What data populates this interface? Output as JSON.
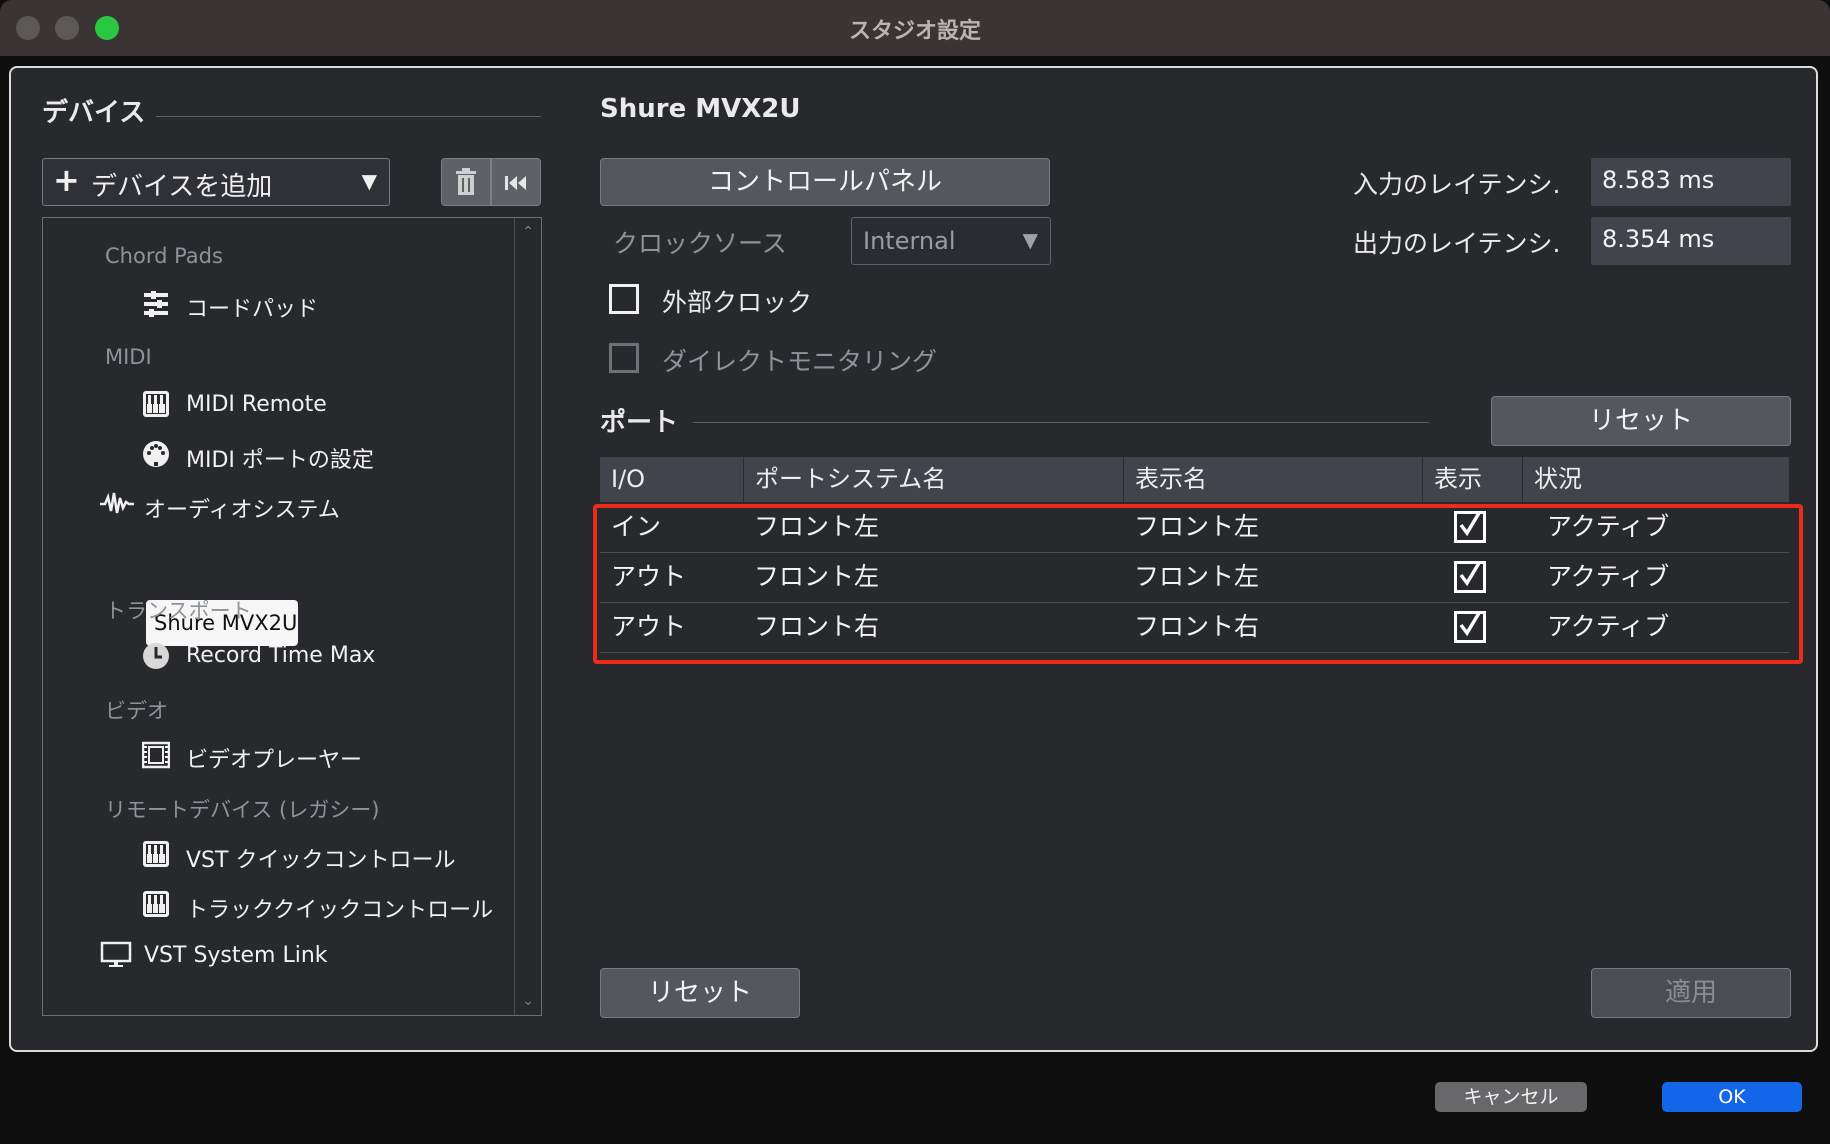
{
  "window": {
    "title": "スタジオ設定"
  },
  "devices": {
    "title": "デバイス",
    "add_label": "デバイスを追加",
    "tree": [
      {
        "kind": "category",
        "label": "Chord Pads"
      },
      {
        "kind": "item",
        "label": "コードパッド",
        "icon": "chord-pads-icon"
      },
      {
        "kind": "category",
        "label": "MIDI"
      },
      {
        "kind": "item",
        "label": "MIDI Remote",
        "icon": "midi-keyboard-icon"
      },
      {
        "kind": "item",
        "label": "MIDI ポートの設定",
        "icon": "midi-port-icon"
      },
      {
        "kind": "category",
        "label": "オーディオシステム",
        "icon": "audio-wave-icon"
      },
      {
        "kind": "item",
        "label": "Shure MVX2U",
        "selected": true
      },
      {
        "kind": "category",
        "label": "トランスポート"
      },
      {
        "kind": "item",
        "label": "Record Time Max",
        "icon": "clock-icon"
      },
      {
        "kind": "category",
        "label": "ビデオ"
      },
      {
        "kind": "item",
        "label": "ビデオプレーヤー",
        "icon": "film-icon"
      },
      {
        "kind": "category",
        "label": "リモートデバイス (レガシー)"
      },
      {
        "kind": "item",
        "label": "VST クイックコントロール",
        "icon": "midi-keyboard-icon"
      },
      {
        "kind": "item",
        "label": "トラッククイックコントロール",
        "icon": "midi-keyboard-icon"
      },
      {
        "kind": "category",
        "label": "VST System Link",
        "icon": "monitor-icon"
      }
    ]
  },
  "device_panel": {
    "name": "Shure MVX2U",
    "control_panel_label": "コントロールパネル",
    "clock_source_label": "クロックソース",
    "clock_source_value": "Internal",
    "external_clock_label": "外部クロック",
    "direct_monitoring_label": "ダイレクトモニタリング",
    "input_latency_label": "入力のレイテンシ.",
    "input_latency_value": "8.583 ms",
    "output_latency_label": "出力のレイテンシ.",
    "output_latency_value": "8.354 ms"
  },
  "ports": {
    "title": "ポート",
    "reset_label": "リセット",
    "headers": [
      "I/O",
      "ポートシステム名",
      "表示名",
      "表示",
      "状況"
    ],
    "rows": [
      {
        "io": "イン",
        "system_name": "フロント左",
        "display_name": "フロント左",
        "visible": true,
        "status": "アクティブ"
      },
      {
        "io": "アウト",
        "system_name": "フロント左",
        "display_name": "フロント左",
        "visible": true,
        "status": "アクティブ"
      },
      {
        "io": "アウト",
        "system_name": "フロント右",
        "display_name": "フロント右",
        "visible": true,
        "status": "アクティブ"
      }
    ]
  },
  "bottom": {
    "reset_label": "リセット",
    "apply_label": "適用"
  },
  "footer": {
    "cancel_label": "キャンセル",
    "ok_label": "OK"
  },
  "colors": {
    "accent": "#1466e8",
    "highlight": "#ee2a1b",
    "mac_green": "#2ac840"
  }
}
